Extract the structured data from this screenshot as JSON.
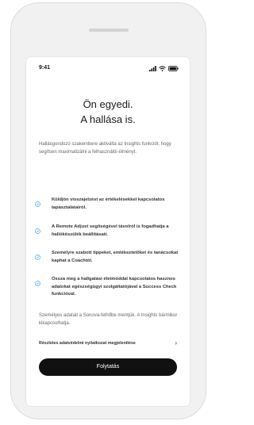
{
  "status_bar": {
    "time": "9:41",
    "icons": [
      "signal-icon",
      "wifi-icon",
      "battery-icon"
    ]
  },
  "title": {
    "line1": "Ön egyedi.",
    "line2": "A hallása is."
  },
  "intro": "Hallásgondozó szakembere aktiválta az Insights funkciót, hogy segítsen maximalizálni a felhasználói élményt.",
  "features": [
    "Küldjön visszajelzést az értékelésekkel kapcsolatos tapasztalatairól.",
    "A Remote Adjust segítségével távolról is fogadhatja a hallókészülék beállításait.",
    "Személyre szabott tippeket, emlékeztetőket és tanácsokat kaphat a Coachtól.",
    "Ossza meg a hallgatási életmóddal kapcsolatos hasznos adatokat egészségügyi szolgáltatójával a Success Check funkcióval."
  ],
  "footer_note": "Személyes adatait a Sonova-felhőbe mentjük. A Insights bármikor kikapcsolhatja.",
  "privacy_link": {
    "label": "Részletes adatvédelmi nyilatkozat megjelenítése",
    "chevron": "›"
  },
  "continue_button": "Folytatás",
  "colors": {
    "accent": "#4aa3df",
    "button": "#111111",
    "button_text": "#ffffff"
  }
}
